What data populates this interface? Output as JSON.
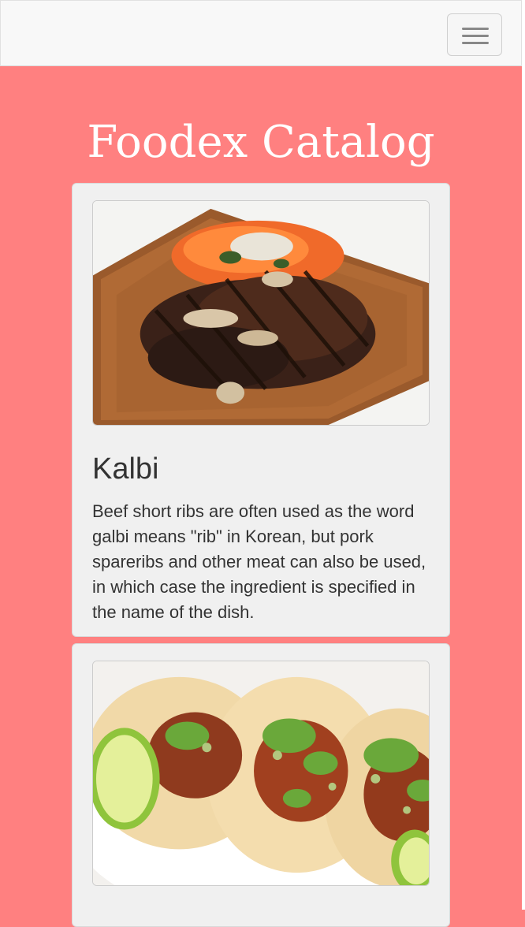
{
  "navbar": {
    "menu_icon": "hamburger-menu-icon"
  },
  "header": {
    "title": "Foodex Catalog"
  },
  "items": [
    {
      "name": "Kalbi",
      "description": "Beef short ribs are often used as the word galbi means \"rib\" in Korean, but pork spareribs and other meat can also be used, in which case the ingredient is specified in the name of the dish."
    },
    {
      "name": ""
    }
  ],
  "colors": {
    "page_background": "#ff8080",
    "navbar_background": "#f8f8f8",
    "card_background": "#f0f0f0",
    "text": "#333333",
    "title": "#ffffff"
  }
}
